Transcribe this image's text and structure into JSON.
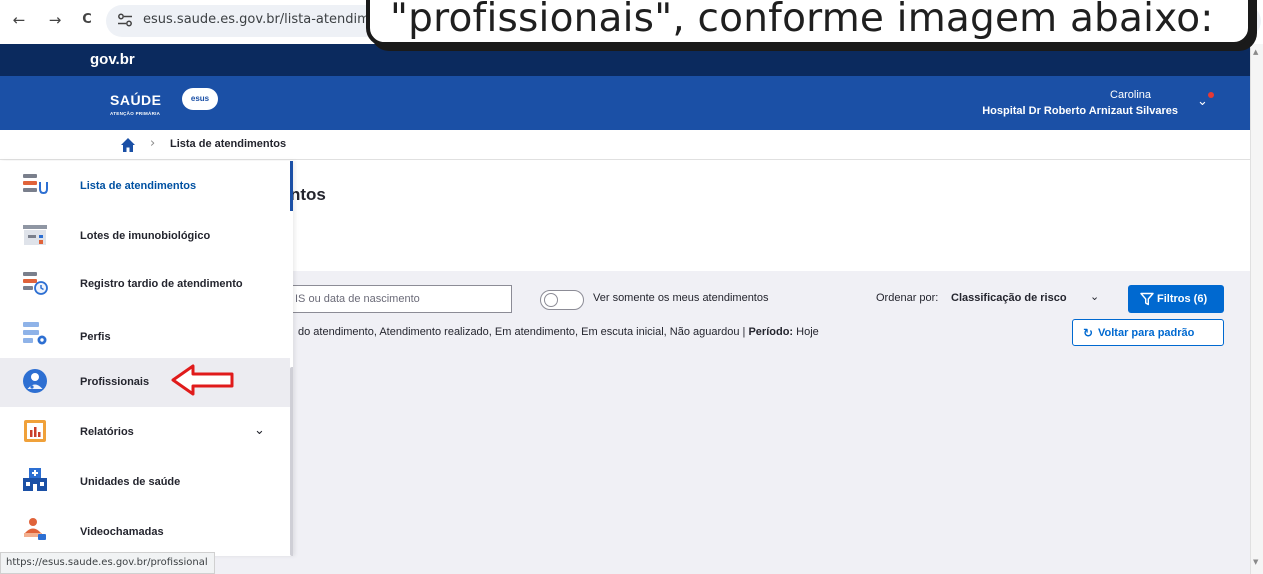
{
  "browser": {
    "back": "←",
    "forward": "→",
    "reload": "C",
    "url": "esus.saude.es.gov.br/lista-atendimento"
  },
  "callout": {
    "text": "\"profissionais\", conforme imagem abaixo:"
  },
  "gov_bar": {
    "logo": "gov.br"
  },
  "header": {
    "logo": "SAÚDE",
    "logo_sub": "ATENÇÃO PRIMÁRIA",
    "badge": "esus",
    "user_name": "Carolina",
    "user_org": "Hospital Dr Roberto Arnizaut Silvares",
    "chevron": "⌄"
  },
  "breadcrumb": {
    "separator": "›",
    "current": "Lista de atendimentos"
  },
  "main": {
    "title": "ntos",
    "search_placeholder": "IS ou data de nascimento",
    "toggle_label": "Ver somente os meus atendimentos",
    "order_label": "Ordenar por:",
    "order_value": "Classificação de risco",
    "order_chevron": "⌄",
    "filter_button": "Filtros (6)",
    "filter_summary_text": "do atendimento, Atendimento realizado, Em atendimento, Em escuta inicial, Não aguardou | ",
    "period_label": "Período:",
    "period_value": " Hoje",
    "reset_icon": "↻",
    "reset_button": "Voltar para padrão"
  },
  "sidebar": {
    "items": [
      {
        "label": "Lista de atendimentos",
        "icon": "list-stethoscope-icon"
      },
      {
        "label": "Lotes de imunobiológico",
        "icon": "vaccine-box-icon"
      },
      {
        "label": "Registro tardio de atendimento",
        "icon": "list-clock-icon"
      },
      {
        "label": "Perfis",
        "icon": "list-gear-icon"
      },
      {
        "label": "Profissionais",
        "icon": "professional-icon"
      },
      {
        "label": "Relatórios",
        "icon": "report-chart-icon",
        "chevron": "⌄"
      },
      {
        "label": "Unidades de saúde",
        "icon": "health-unit-icon"
      },
      {
        "label": "Videochamadas",
        "icon": "video-call-icon"
      }
    ]
  },
  "status_url": "https://esus.saude.es.gov.br/profissional",
  "colors": {
    "gov_bar": "#0b2a5e",
    "header": "#1b50a6",
    "primary": "#0069d0",
    "arrow": "#e01b1b"
  }
}
